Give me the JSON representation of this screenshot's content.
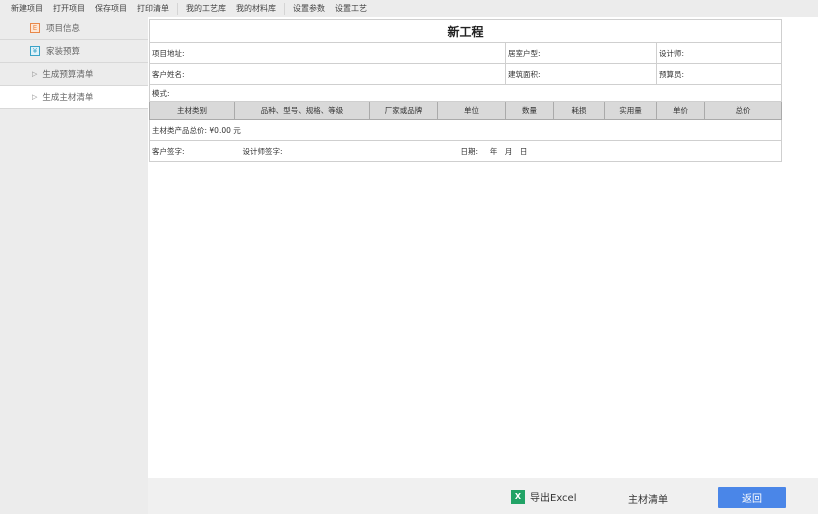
{
  "toolbar": [
    "新建项目",
    "打开项目",
    "保存项目",
    "打印清单",
    "我的工艺库",
    "我的材料库",
    "设置参数",
    "设置工艺"
  ],
  "sidebar": {
    "items": [
      {
        "label": "项目信息",
        "icon": "project-info-icon"
      },
      {
        "label": "家装预算",
        "icon": "yuan-icon"
      },
      {
        "label": "生成预算清单"
      },
      {
        "label": "生成主材清单"
      }
    ]
  },
  "doc": {
    "title": "新工程",
    "project_address": "项目地址:",
    "house_type": "居室户型:",
    "designer": "设计师:",
    "customer_name": "客户姓名:",
    "area": "建筑面积:",
    "budgeter": "预算员:",
    "mode": "模式:",
    "headers": [
      "主材类别",
      "品种、型号、规格、等级",
      "厂家或品牌",
      "单位",
      "数量",
      "耗损",
      "实用量",
      "单价",
      "总价"
    ],
    "total": "主材类产品总价: ¥0.00 元",
    "customer_sign": "客户签字:",
    "designer_sign": "设计师签字:",
    "date": "日期:　 年　月　日"
  },
  "bottom": {
    "export": "导出Excel",
    "list": "主材清单",
    "back": "返回"
  },
  "colors": {
    "accent": "#4a86e8",
    "excel": "#21a366"
  }
}
